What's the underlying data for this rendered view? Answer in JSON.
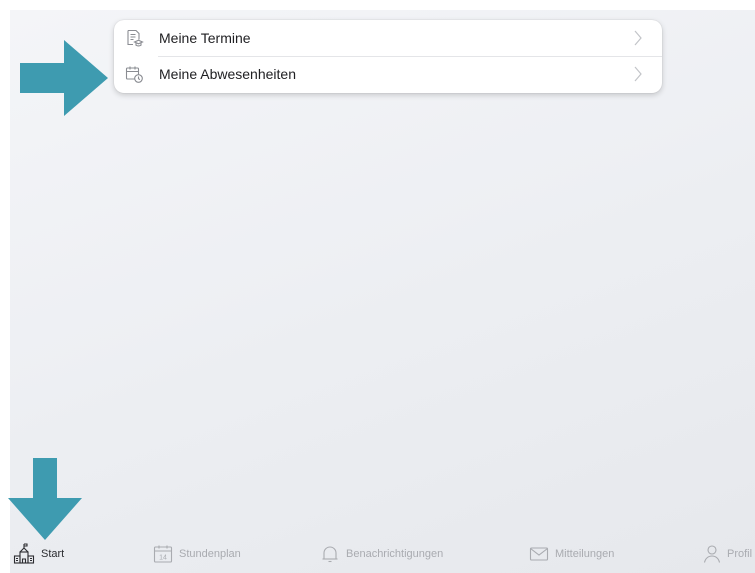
{
  "menu": {
    "items": [
      {
        "label": "Meine Termine",
        "icon": "document-graduation-icon"
      },
      {
        "label": "Meine Abwesenheiten",
        "icon": "calendar-clock-icon"
      }
    ]
  },
  "tabbar": {
    "tabs": [
      {
        "label": "Start",
        "icon": "school-building-icon",
        "active": true
      },
      {
        "label": "Stundenplan",
        "icon": "calendar-14-icon",
        "icon_text": "14",
        "active": false
      },
      {
        "label": "Benachrichtigungen",
        "icon": "bell-icon",
        "active": false
      },
      {
        "label": "Mitteilungen",
        "icon": "envelope-icon",
        "active": false
      },
      {
        "label": "Profil",
        "icon": "person-icon",
        "active": false
      }
    ]
  },
  "annotations": {
    "arrow_color": "#3e9bb0"
  },
  "colors": {
    "background": "#eceef2",
    "card": "#ffffff",
    "text": "#1f1f22",
    "inactive_tab": "#a9abb0"
  }
}
